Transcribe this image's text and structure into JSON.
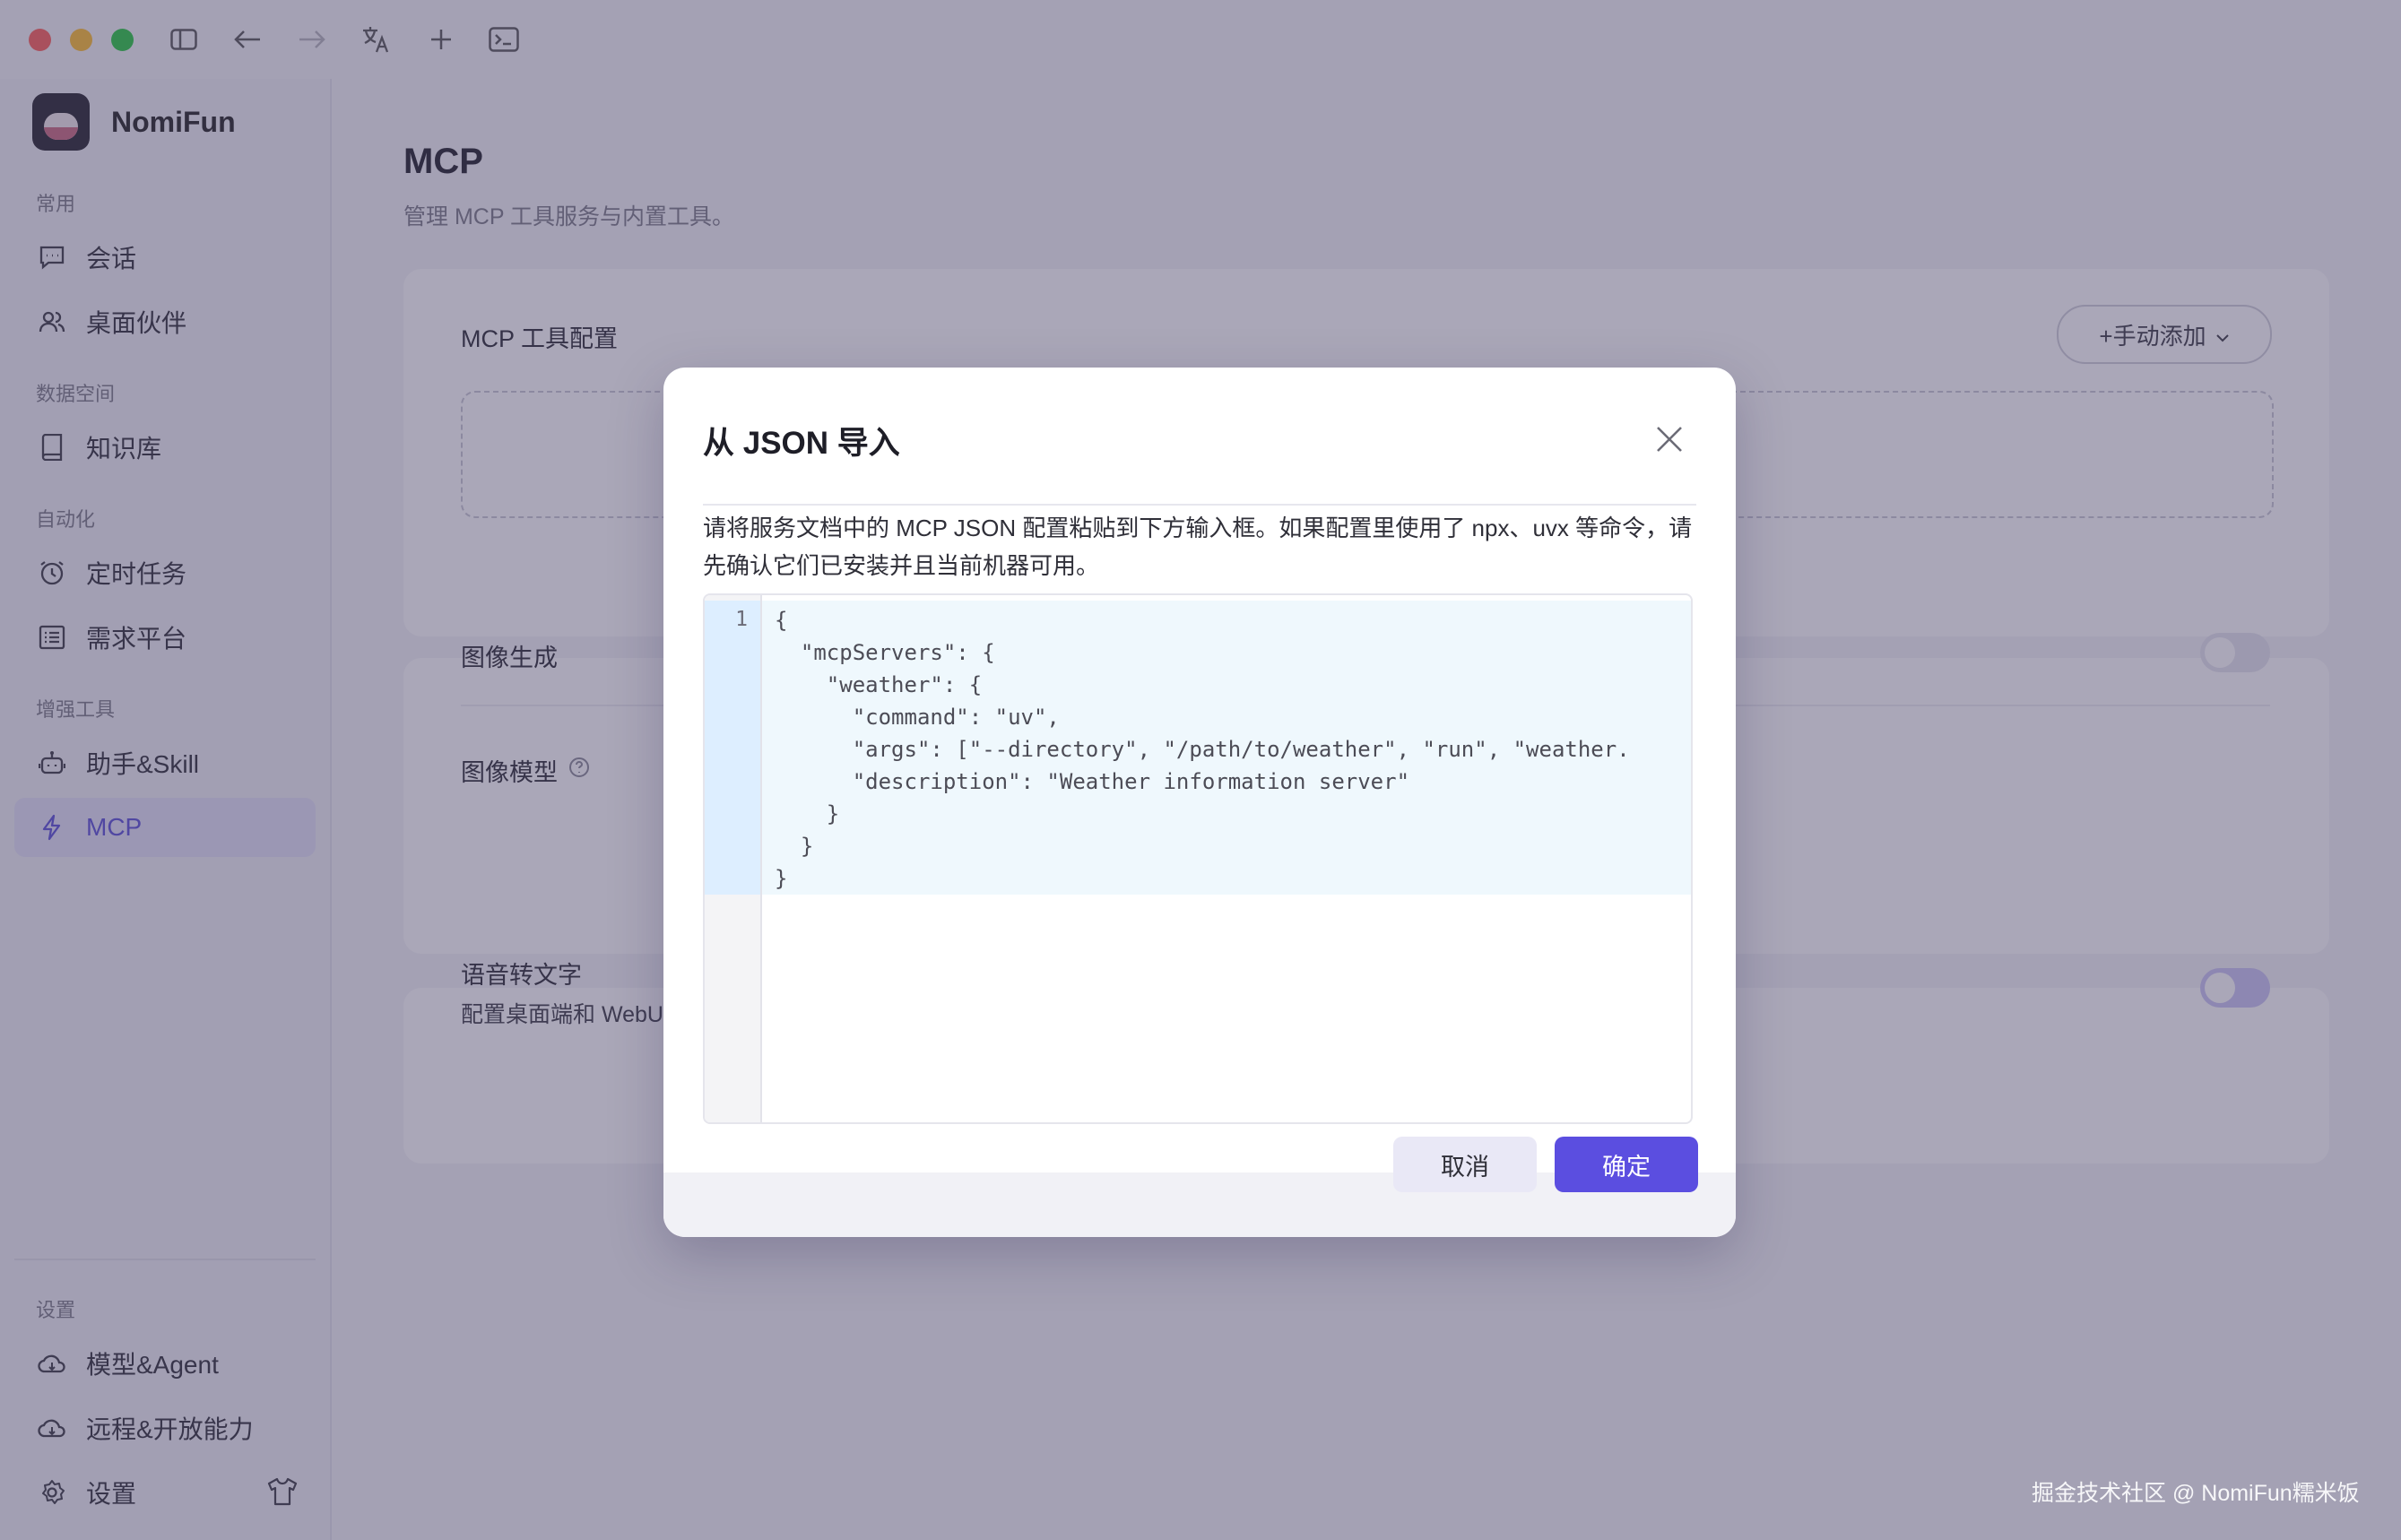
{
  "sidebar": {
    "brand": "NomiFun",
    "sections": {
      "common": "常用",
      "data_space": "数据空间",
      "automation": "自动化",
      "tools": "增强工具",
      "settings": "设置"
    },
    "items": {
      "chat": "会话",
      "companion": "桌面伙伴",
      "knowledge": "知识库",
      "scheduled": "定时任务",
      "demand": "需求平台",
      "assistant": "助手&Skill",
      "mcp": "MCP",
      "model": "模型&Agent",
      "remote": "远程&开放能力",
      "settings": "设置"
    }
  },
  "main": {
    "title": "MCP",
    "subtitle": "管理 MCP 工具服务与内置工具。",
    "mcp_config_title": "MCP 工具配置",
    "add_button": "+手动添加",
    "image_gen_title": "图像生成",
    "image_model_label": "图像模型",
    "stt_title": "语音转文字",
    "stt_desc": "配置桌面端和 WebU"
  },
  "modal": {
    "title": "从 JSON 导入",
    "description": "请将服务文档中的 MCP JSON 配置粘贴到下方输入框。如果配置里使用了 npx、uvx 等命令，请先确认它们已安装并且当前机器可用。",
    "line_number": "1",
    "code": "{\n  \"mcpServers\": {\n    \"weather\": {\n      \"command\": \"uv\",\n      \"args\": [\"--directory\", \"/path/to/weather\", \"run\", \"weather.\n      \"description\": \"Weather information server\"\n    }\n  }\n}",
    "cancel": "取消",
    "confirm": "确定"
  },
  "watermark": "掘金技术社区 @ NomiFun糯米饭",
  "colors": {
    "accent": "#5b4ee0",
    "active_nav_bg": "#e3e2f7",
    "overlay": "rgba(70,64,100,0.46)"
  }
}
